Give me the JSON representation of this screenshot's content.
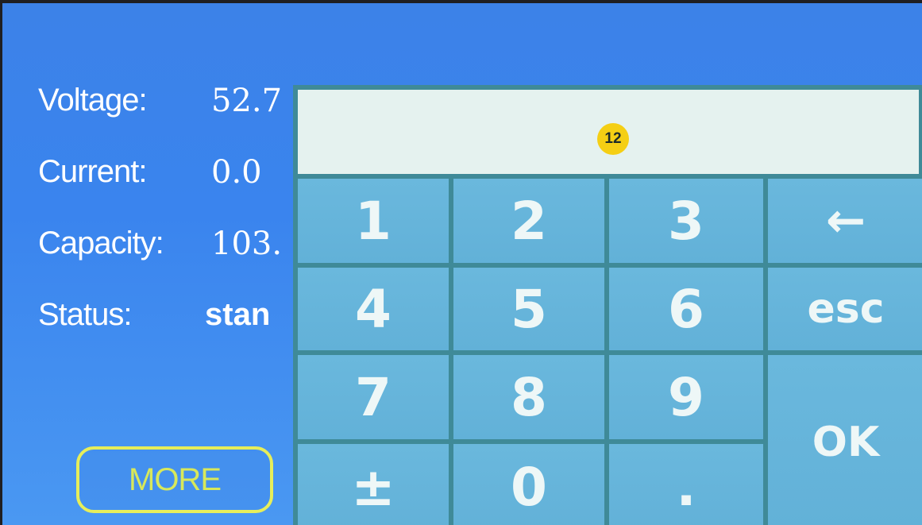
{
  "info": {
    "voltage": {
      "label": "Voltage:",
      "value": "52.7"
    },
    "current": {
      "label": "Current:",
      "value": "0.0"
    },
    "capacity": {
      "label": "Capacity:",
      "value": "103."
    },
    "status": {
      "label": "Status:",
      "value": "stan"
    }
  },
  "more_button": "MORE",
  "keypad": {
    "display_value": "",
    "marker": "12",
    "keys": {
      "k1": "1",
      "k2": "2",
      "k3": "3",
      "backspace": "←",
      "k4": "4",
      "k5": "5",
      "k6": "6",
      "esc": "esc",
      "k7": "7",
      "k8": "8",
      "k9": "9",
      "ok": "OK",
      "plusminus": "±",
      "k0": "0",
      "dot": "."
    }
  },
  "colors": {
    "screen_bg": "#3a84ee",
    "key_bg": "#62b1d8",
    "keypad_grid": "#3f8a98",
    "display_bg": "#e5f2ef",
    "more_border": "#e6ee5a",
    "marker": "#f5cf14"
  }
}
